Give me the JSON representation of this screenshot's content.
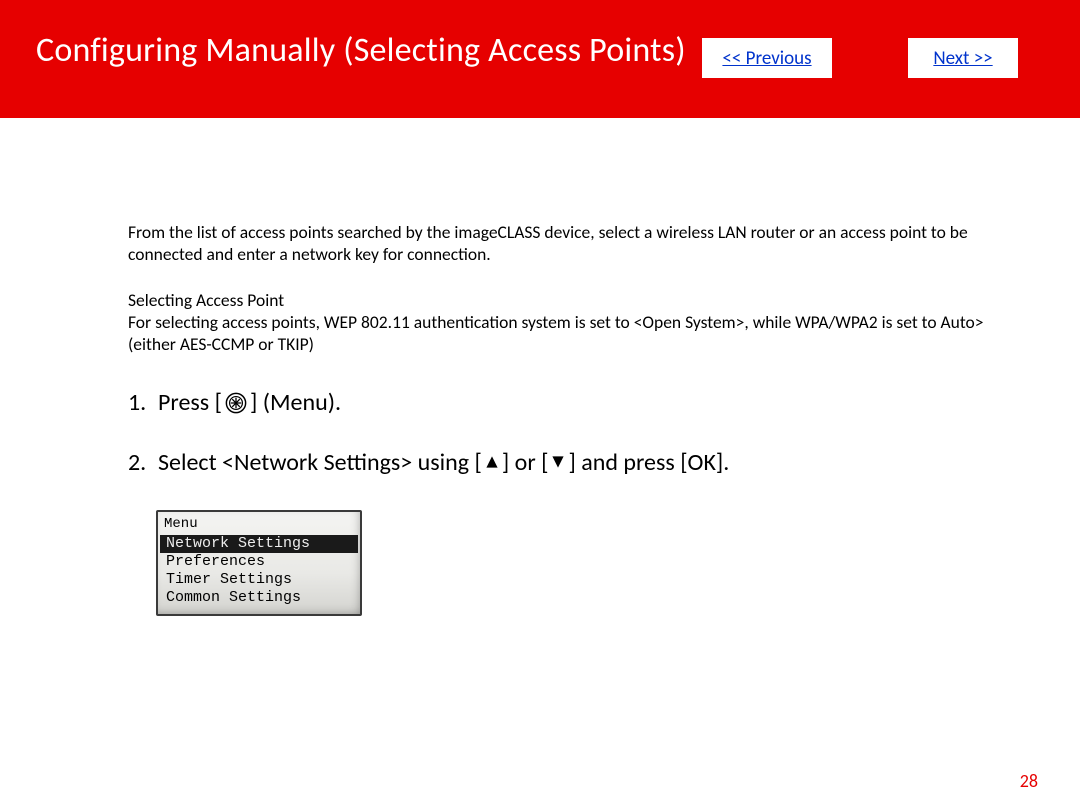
{
  "header": {
    "title": "Configuring Manually (Selecting Access Points)",
    "prev_label": "<< Previous",
    "next_label": "Next >>"
  },
  "intro": {
    "p1": "From the list of access points searched by the imageCLASS device, select a wireless LAN router or an access point to be connected and enter a network key for connection."
  },
  "sub": {
    "heading": "Selecting Access Point",
    "body": "For selecting access points, WEP 802.11 authentication system is set to <Open System>, while WPA/WPA2 is set to Auto> (either AES-CCMP or TKIP)"
  },
  "steps": {
    "s1_num": "1.",
    "s1_a": "Press [ ",
    "s1_b": " ] (Menu).",
    "s2_num": "2.",
    "s2_a": "Select <Network Settings> using [",
    "s2_b": "] or [",
    "s2_c": "] and press [OK]."
  },
  "lcd": {
    "title": "Menu",
    "items": [
      "Network Settings",
      "Preferences",
      "Timer Settings",
      "Common Settings"
    ],
    "selected_index": 0
  },
  "page_number": "28"
}
